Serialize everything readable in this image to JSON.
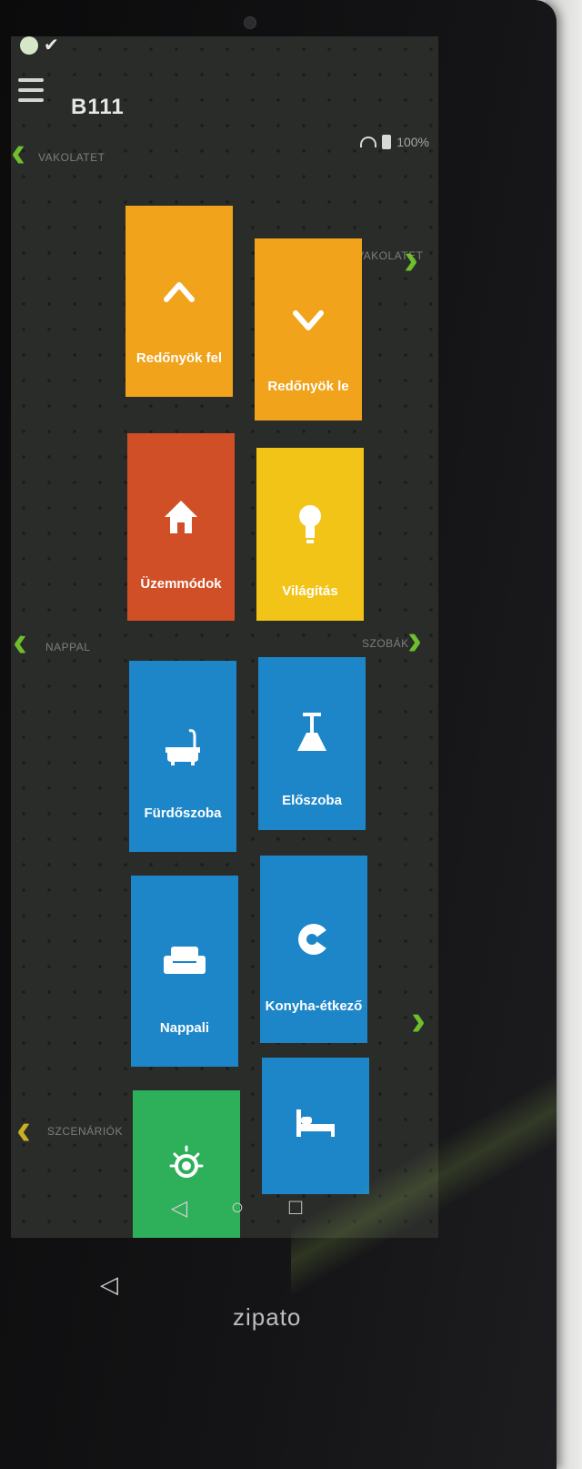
{
  "header": {
    "title": "B111"
  },
  "status_bar": {
    "battery_text": "100%"
  },
  "side_nav": [
    {
      "label": "Vakolatet",
      "direction": "left"
    },
    {
      "label": "Vakolatet",
      "direction": "right"
    },
    {
      "label": "Nappal",
      "direction": "left"
    },
    {
      "label": "Szobák",
      "direction": "right"
    },
    {
      "label": "",
      "direction": "right"
    },
    {
      "label": "Szcenáriók",
      "direction": "left"
    }
  ],
  "tiles": [
    {
      "label": "Redőnyök fel",
      "icon": "chevron-up-icon",
      "color": "#f0a31b"
    },
    {
      "label": "Redőnyök le",
      "icon": "chevron-down-icon",
      "color": "#f0a31b"
    },
    {
      "label": "Üzemmódok",
      "icon": "house-icon",
      "color": "#d04f26"
    },
    {
      "label": "Világítás",
      "icon": "light-bulb-icon",
      "color": "#f2c417"
    },
    {
      "label": "Fürdőszoba",
      "icon": "bathtub-icon",
      "color": "#1d86c9"
    },
    {
      "label": "Előszoba",
      "icon": "ceiling-lamp-icon",
      "color": "#1d86c9"
    },
    {
      "label": "Nappali",
      "icon": "sofa-icon",
      "color": "#1d86c9"
    },
    {
      "label": "Konyha-étkező",
      "icon": "kitchen-icon",
      "color": "#1d86c9"
    },
    {
      "label": "",
      "icon": "sun-icon",
      "color": "#2eaf5a"
    },
    {
      "label": "",
      "icon": "bed-icon",
      "color": "#1d86c9"
    }
  ],
  "system_nav": {
    "back": "◁",
    "home": "○",
    "recents": "□"
  },
  "brand": {
    "logo_text": "zipato"
  },
  "colors": {
    "accent": "#6fbe2d",
    "screen_bg": "#2a2c2a"
  }
}
